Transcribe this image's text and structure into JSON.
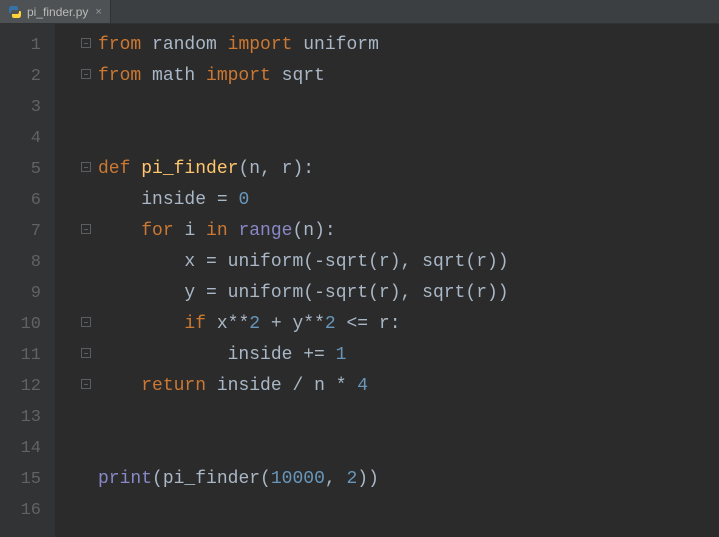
{
  "tab": {
    "filename": "pi_finder.py"
  },
  "lines": [
    {
      "n": "1",
      "fold": true,
      "tokens": [
        [
          "kw",
          "from"
        ],
        [
          "",
          ""
        ],
        [
          "name",
          " random "
        ],
        [
          "kw",
          "import"
        ],
        [
          "name",
          " uniform"
        ]
      ]
    },
    {
      "n": "2",
      "fold": true,
      "tokens": [
        [
          "kw",
          "from"
        ],
        [
          "name",
          " math "
        ],
        [
          "kw",
          "import"
        ],
        [
          "name",
          " sqrt"
        ]
      ]
    },
    {
      "n": "3",
      "fold": false,
      "tokens": []
    },
    {
      "n": "4",
      "fold": false,
      "tokens": []
    },
    {
      "n": "5",
      "fold": true,
      "tokens": [
        [
          "kw",
          "def "
        ],
        [
          "deffn",
          "pi_finder"
        ],
        [
          "op",
          "("
        ],
        [
          "name",
          "n"
        ],
        [
          "op",
          ", "
        ],
        [
          "name",
          "r"
        ],
        [
          "op",
          ")"
        ],
        [
          "op",
          ":"
        ]
      ]
    },
    {
      "n": "6",
      "fold": false,
      "tokens": [
        [
          "",
          "    "
        ],
        [
          "name",
          "inside "
        ],
        [
          "op",
          "= "
        ],
        [
          "num",
          "0"
        ]
      ]
    },
    {
      "n": "7",
      "fold": true,
      "tokens": [
        [
          "",
          "    "
        ],
        [
          "kw",
          "for "
        ],
        [
          "name",
          "i "
        ],
        [
          "kw",
          "in "
        ],
        [
          "builtin",
          "range"
        ],
        [
          "op",
          "("
        ],
        [
          "name",
          "n"
        ],
        [
          "op",
          ")"
        ],
        [
          "op",
          ":"
        ]
      ]
    },
    {
      "n": "8",
      "fold": false,
      "tokens": [
        [
          "",
          "        "
        ],
        [
          "name",
          "x "
        ],
        [
          "op",
          "= "
        ],
        [
          "call",
          "uniform"
        ],
        [
          "op",
          "("
        ],
        [
          "op",
          "-"
        ],
        [
          "call",
          "sqrt"
        ],
        [
          "op",
          "("
        ],
        [
          "name",
          "r"
        ],
        [
          "op",
          ")"
        ],
        [
          "op",
          ", "
        ],
        [
          "call",
          "sqrt"
        ],
        [
          "op",
          "("
        ],
        [
          "name",
          "r"
        ],
        [
          "op",
          "))"
        ]
      ]
    },
    {
      "n": "9",
      "fold": false,
      "tokens": [
        [
          "",
          "        "
        ],
        [
          "name",
          "y "
        ],
        [
          "op",
          "= "
        ],
        [
          "call",
          "uniform"
        ],
        [
          "op",
          "("
        ],
        [
          "op",
          "-"
        ],
        [
          "call",
          "sqrt"
        ],
        [
          "op",
          "("
        ],
        [
          "name",
          "r"
        ],
        [
          "op",
          ")"
        ],
        [
          "op",
          ", "
        ],
        [
          "call",
          "sqrt"
        ],
        [
          "op",
          "("
        ],
        [
          "name",
          "r"
        ],
        [
          "op",
          "))"
        ]
      ]
    },
    {
      "n": "10",
      "fold": true,
      "tokens": [
        [
          "",
          "        "
        ],
        [
          "kw",
          "if "
        ],
        [
          "name",
          "x"
        ],
        [
          "op",
          "**"
        ],
        [
          "num",
          "2"
        ],
        [
          "op",
          " + "
        ],
        [
          "name",
          "y"
        ],
        [
          "op",
          "**"
        ],
        [
          "num",
          "2"
        ],
        [
          "op",
          " <= "
        ],
        [
          "name",
          "r"
        ],
        [
          "op",
          ":"
        ]
      ]
    },
    {
      "n": "11",
      "fold": true,
      "tokens": [
        [
          "",
          "            "
        ],
        [
          "name",
          "inside "
        ],
        [
          "op",
          "+= "
        ],
        [
          "num",
          "1"
        ]
      ]
    },
    {
      "n": "12",
      "fold": true,
      "tokens": [
        [
          "",
          "    "
        ],
        [
          "kw",
          "return "
        ],
        [
          "name",
          "inside "
        ],
        [
          "op",
          "/ "
        ],
        [
          "name",
          "n "
        ],
        [
          "op",
          "* "
        ],
        [
          "num",
          "4"
        ]
      ]
    },
    {
      "n": "13",
      "fold": false,
      "tokens": []
    },
    {
      "n": "14",
      "fold": false,
      "tokens": []
    },
    {
      "n": "15",
      "fold": false,
      "tokens": [
        [
          "builtin",
          "print"
        ],
        [
          "op",
          "("
        ],
        [
          "call",
          "pi_finder"
        ],
        [
          "op",
          "("
        ],
        [
          "num",
          "10000"
        ],
        [
          "op",
          ", "
        ],
        [
          "num",
          "2"
        ],
        [
          "op",
          "))"
        ]
      ]
    },
    {
      "n": "16",
      "fold": false,
      "tokens": []
    }
  ]
}
